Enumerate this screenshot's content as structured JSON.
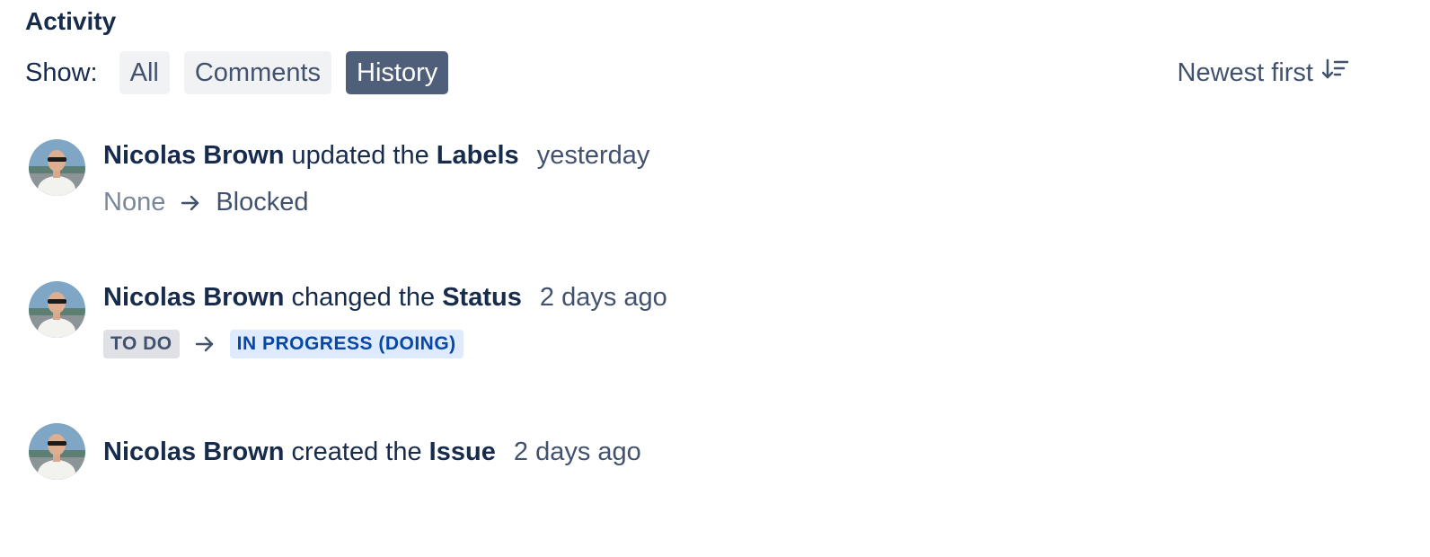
{
  "activity": {
    "title": "Activity",
    "show_label": "Show:",
    "filters": [
      {
        "label": "All",
        "active": false
      },
      {
        "label": "Comments",
        "active": false
      },
      {
        "label": "History",
        "active": true
      }
    ],
    "sort_label": "Newest first",
    "sort_icon": "sort-descending-icon"
  },
  "entries": [
    {
      "actor": "Nicolas Brown",
      "verb": "updated the",
      "field": "Labels",
      "time": "yesterday",
      "change": {
        "from": "None",
        "to": "Blocked",
        "style": "text"
      }
    },
    {
      "actor": "Nicolas Brown",
      "verb": "changed the",
      "field": "Status",
      "time": "2 days ago",
      "change": {
        "from": "TO DO",
        "to": "IN PROGRESS (DOING)",
        "style": "lozenge"
      }
    },
    {
      "actor": "Nicolas Brown",
      "verb": "created the",
      "field": "Issue",
      "time": "2 days ago"
    }
  ],
  "colors": {
    "active_filter_bg": "#505f79",
    "filter_bg": "#f1f2f4",
    "todo_lozenge_bg": "#dfe1e6",
    "progress_lozenge_bg": "#deebff",
    "progress_lozenge_text": "#0747a6"
  }
}
